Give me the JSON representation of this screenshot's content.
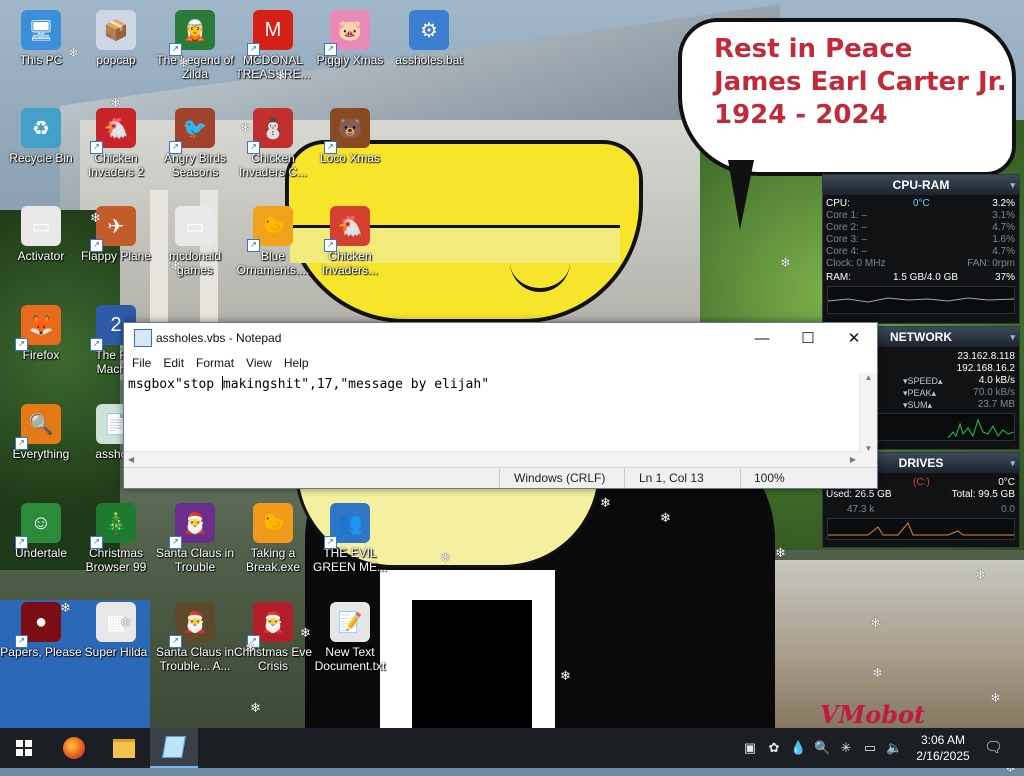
{
  "desktop_icons": [
    {
      "name": "this-pc",
      "label": "This PC",
      "glyph": "🖥",
      "color": "#3b8fd9",
      "shortcut": false
    },
    {
      "name": "popcap",
      "label": "popcap",
      "glyph": "📦",
      "color": "#cfd6e6",
      "shortcut": false
    },
    {
      "name": "legend-of-zilda",
      "label": "The Legend of Zilda",
      "glyph": "🧝",
      "color": "#2a7a3a",
      "shortcut": true
    },
    {
      "name": "mcdonalds-treasure",
      "label": "MCDONAL TREASURE...",
      "glyph": "M",
      "color": "#d62016",
      "shortcut": true
    },
    {
      "name": "piggly-xmas",
      "label": "Piggly Xmas",
      "glyph": "🐷",
      "color": "#e889b8",
      "shortcut": true
    },
    {
      "name": "assholes-bat",
      "label": "assholes.bat",
      "glyph": "⚙",
      "color": "#3c7fd0",
      "shortcut": false
    },
    {
      "name": "recycle-bin",
      "label": "Recycle Bin",
      "glyph": "♻",
      "color": "#43a0c9",
      "shortcut": false
    },
    {
      "name": "chicken-invaders-2",
      "label": "Chicken Invaders 2",
      "glyph": "🐔",
      "color": "#c8252b",
      "shortcut": true
    },
    {
      "name": "angry-birds-seasons",
      "label": "Angry Birds Seasons",
      "glyph": "🐦",
      "color": "#a0422c",
      "shortcut": true
    },
    {
      "name": "chicken-invaders-c",
      "label": "Chicken Invaders C...",
      "glyph": "⛄",
      "color": "#c22f2f",
      "shortcut": true
    },
    {
      "name": "loco-xmas",
      "label": "Loco Xmas",
      "glyph": "🐻",
      "color": "#8a4a1f",
      "shortcut": true
    },
    {
      "name": "activator",
      "label": "Activator",
      "glyph": "▭",
      "color": "#e8e8e8",
      "shortcut": false
    },
    {
      "name": "flappy-plane",
      "label": "Flappy Plane",
      "glyph": "✈",
      "color": "#c25c2a",
      "shortcut": true
    },
    {
      "name": "mcdonald-games",
      "label": "mcdonald games",
      "glyph": "▭",
      "color": "#e8e8e8",
      "shortcut": false
    },
    {
      "name": "blue-ornaments",
      "label": "Blue Ornaments....",
      "glyph": "🐤",
      "color": "#f0a21b",
      "shortcut": true
    },
    {
      "name": "chicken-invaders",
      "label": "Chicken Invaders...",
      "glyph": "🐔",
      "color": "#d64030",
      "shortcut": true
    },
    {
      "name": "firefox",
      "label": "Firefox",
      "glyph": "🦊",
      "color": "#e86a1c",
      "shortcut": true
    },
    {
      "name": "the-polar-machine",
      "label": "The Pol Machin",
      "glyph": "2",
      "color": "#2d5ba8",
      "shortcut": true
    },
    {
      "name": "everything",
      "label": "Everything",
      "glyph": "🔍",
      "color": "#e37a16",
      "shortcut": true
    },
    {
      "name": "assholes-vbs",
      "label": "asshole",
      "glyph": "📄",
      "color": "#d0e2d8",
      "shortcut": false
    },
    {
      "name": "undertale",
      "label": "Undertale",
      "glyph": "☺",
      "color": "#2c8a3b",
      "shortcut": true
    },
    {
      "name": "christmas-browser-99",
      "label": "Christmas Browser 99",
      "glyph": "🎄",
      "color": "#1e7a2e",
      "shortcut": true
    },
    {
      "name": "santa-claus-in-trouble",
      "label": "Santa Claus in Trouble",
      "glyph": "🎅",
      "color": "#6a2f8a",
      "shortcut": true
    },
    {
      "name": "taking-a-break",
      "label": "Taking a Break.exe",
      "glyph": "🐤",
      "color": "#f09a1b",
      "shortcut": false
    },
    {
      "name": "the-evil-green-me",
      "label": "THE EVIL GREEN ME...",
      "glyph": "👥",
      "color": "#2f77c6",
      "shortcut": true
    },
    {
      "name": "papers-please",
      "label": "Papers, Please",
      "glyph": "●",
      "color": "#7a0e14",
      "shortcut": true
    },
    {
      "name": "super-hilda",
      "label": "Super Hilda",
      "glyph": "▦",
      "color": "#e8e8e8",
      "shortcut": false
    },
    {
      "name": "santa-claus-in-trouble-a",
      "label": "Santa Claus in Trouble... A...",
      "glyph": "🎅",
      "color": "#5d4a2a",
      "shortcut": true
    },
    {
      "name": "christmas-eve-crisis",
      "label": "Christmas Eve Crisis",
      "glyph": "🎅",
      "color": "#b21f2a",
      "shortcut": true
    },
    {
      "name": "new-text-document",
      "label": "New Text Document.txt",
      "glyph": "📝",
      "color": "#e6e6e6",
      "shortcut": false
    }
  ],
  "bubble": {
    "line1": "Rest in Peace",
    "line2": "James Earl Carter Jr.",
    "line3": "1924 - 2024"
  },
  "watermark": "VMobot",
  "notepad": {
    "title": "assholes.vbs - Notepad",
    "menus": [
      "File",
      "Edit",
      "Format",
      "View",
      "Help"
    ],
    "content_before": "msgbox\"stop ",
    "content_after": "makingshit\",17,\"message by elijah\"",
    "status_line_ending": "Windows (CRLF)",
    "status_position": "Ln 1, Col 13",
    "status_zoom": "100%",
    "btn_minimize": "—",
    "btn_maximize": "☐",
    "btn_close": "✕"
  },
  "cpu_ram": {
    "title": "CPU-RAM",
    "cpu_label": "CPU:",
    "cpu_temp": "0°C",
    "cpu_usage": "3.2%",
    "cores": [
      {
        "label": "Core 1:",
        "dash": "–",
        "value": "3.1%"
      },
      {
        "label": "Core 2:",
        "dash": "–",
        "value": "4.7%"
      },
      {
        "label": "Core 3:",
        "dash": "–",
        "value": "1.6%"
      },
      {
        "label": "Core 4:",
        "dash": "–",
        "value": "4.7%"
      }
    ],
    "clock": "Clock: 0 MHz",
    "fan": "FAN: 0rpm",
    "ram_label": "RAM:",
    "ram_used": "1.5 GB/4.0 GB",
    "ram_pct": "37%"
  },
  "network": {
    "title": "NETWORK",
    "ip_external": "23.162.8.118",
    "ip_internal": "192.168.16.2",
    "speed_label": "▾SPEED▴",
    "speed": "4.0 kB/s",
    "peak_label": "▾PEAK▴",
    "peak": "70.0 kB/s",
    "sum_label": "▾SUM▴",
    "sum": "23.7 MB"
  },
  "drives": {
    "title": "DRIVES",
    "drive": "(C:)",
    "temp": "0°C",
    "used": "Used: 26.5 GB",
    "total": "Total: 99.5 GB",
    "read": "47.3 k",
    "write": "0.0"
  },
  "taskbar": {
    "time": "3:06 AM",
    "date": "2/16/2025",
    "apps": [
      "start-icon",
      "firefox-icon",
      "file-explorer-icon",
      "notepad-icon"
    ]
  }
}
